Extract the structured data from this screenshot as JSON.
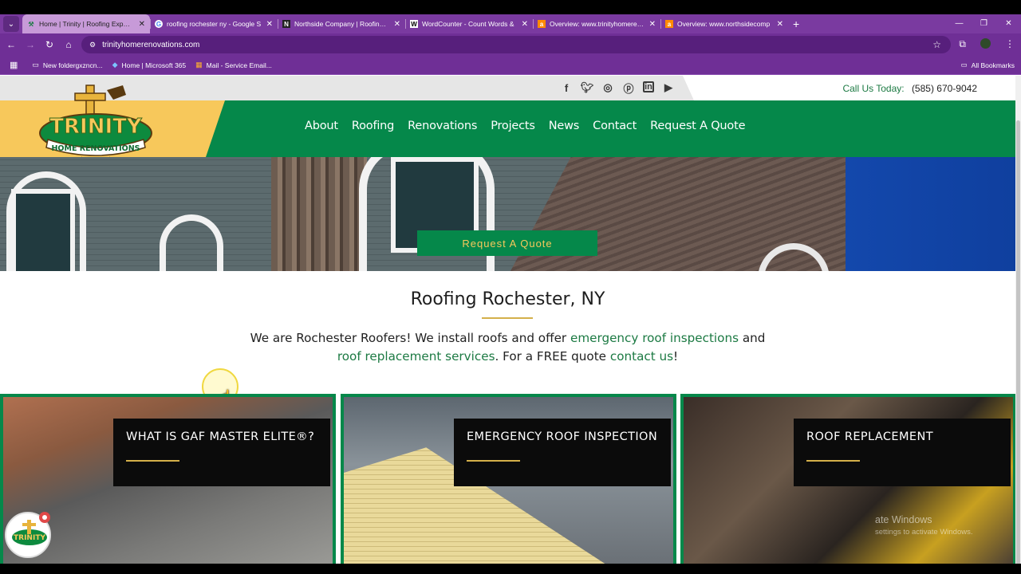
{
  "browser": {
    "tabs": [
      {
        "title": "Home | Trinity | Roofing Experts",
        "favicon": "hammer-icon",
        "active": true
      },
      {
        "title": "roofing rochester ny - Google S",
        "favicon": "google-icon",
        "active": false
      },
      {
        "title": "Northside Company | Roofing &",
        "favicon": "n-icon",
        "active": false
      },
      {
        "title": "WordCounter - Count Words &",
        "favicon": "w-icon",
        "active": false
      },
      {
        "title": "Overview: www.trinityhomerenov",
        "favicon": "ahrefs-icon",
        "active": false
      },
      {
        "title": "Overview: www.northsidecomp",
        "favicon": "ahrefs-icon",
        "active": false
      }
    ],
    "url": "trinityhomerenovations.com",
    "bookmarks": [
      {
        "label": "New foldergxzncn...",
        "icon": "folder-icon"
      },
      {
        "label": "Home | Microsoft 365",
        "icon": "microsoft365-icon"
      },
      {
        "label": "Mail - Service Email...",
        "icon": "outlook-icon"
      }
    ],
    "all_bookmarks": "All Bookmarks"
  },
  "site": {
    "call_label": "Call Us Today:",
    "phone": "(585) 670-9042",
    "social": [
      "facebook-icon",
      "twitter-icon",
      "instagram-icon",
      "pinterest-icon",
      "linkedin-icon",
      "youtube-icon"
    ],
    "logo_text": "TRINITY",
    "logo_subtext": "HOME RENOVATIONS",
    "nav": [
      "About",
      "Roofing",
      "Renovations",
      "Projects",
      "News",
      "Contact",
      "Request A Quote"
    ],
    "hero_button": "Request A Quote",
    "heading": "Roofing Rochester, NY",
    "intro": {
      "t1": "We are Rochester Roofers! We install roofs and offer ",
      "link1": "emergency roof inspections",
      "t2": " and ",
      "link2": "roof replacement services",
      "t3": ". For a FREE quote ",
      "link3": "contact us",
      "t4": "!"
    },
    "cards": [
      {
        "title": "WHAT IS GAF MASTER ELITE®?"
      },
      {
        "title": "EMERGENCY ROOF INSPECTION"
      },
      {
        "title": "ROOF REPLACEMENT"
      }
    ]
  },
  "watermark": {
    "title": "ate Windows",
    "sub": "settings to activate Windows."
  },
  "colors": {
    "brand_green": "#05884a",
    "brand_gold": "#f7c85b",
    "browser_purple": "#6f2f96"
  }
}
